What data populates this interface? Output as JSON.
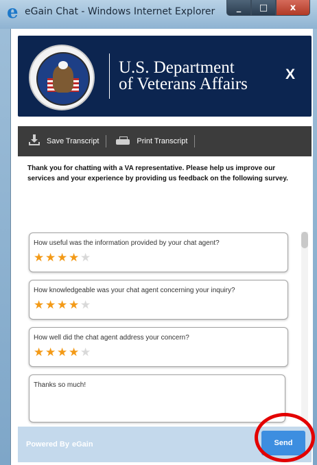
{
  "window": {
    "title": "eGain Chat - Windows Internet Explorer",
    "minimize": "_",
    "maximize": "□",
    "close": "x"
  },
  "header": {
    "agency_line1": "U.S. Department",
    "agency_line2": "of Veterans Affairs",
    "close_label": "X"
  },
  "toolbar": {
    "save_label": "Save Transcript",
    "print_label": "Print Transcript"
  },
  "intro": "Thank you for chatting with a VA representative. Please help us improve our services and your experience by providing us feedback on the following survey.",
  "questions": [
    {
      "text": "How useful was the information provided by your chat agent?",
      "rating": 4,
      "max": 5
    },
    {
      "text": "How knowledgeable was your chat agent concerning your inquiry?",
      "rating": 4,
      "max": 5
    },
    {
      "text": "How well did the chat agent address your concern?",
      "rating": 4,
      "max": 5
    }
  ],
  "comment": "Thanks so much!",
  "footer": {
    "powered_by": "Powered By",
    "brand": "eGain",
    "send_label": "Send"
  },
  "colors": {
    "header_bg": "#0c2550",
    "toolbar_bg": "#3c3c3c",
    "footer_bg": "#c4d9ec",
    "send_bg": "#3d8ee0",
    "star_on": "#f39a17",
    "highlight": "#e30000"
  }
}
